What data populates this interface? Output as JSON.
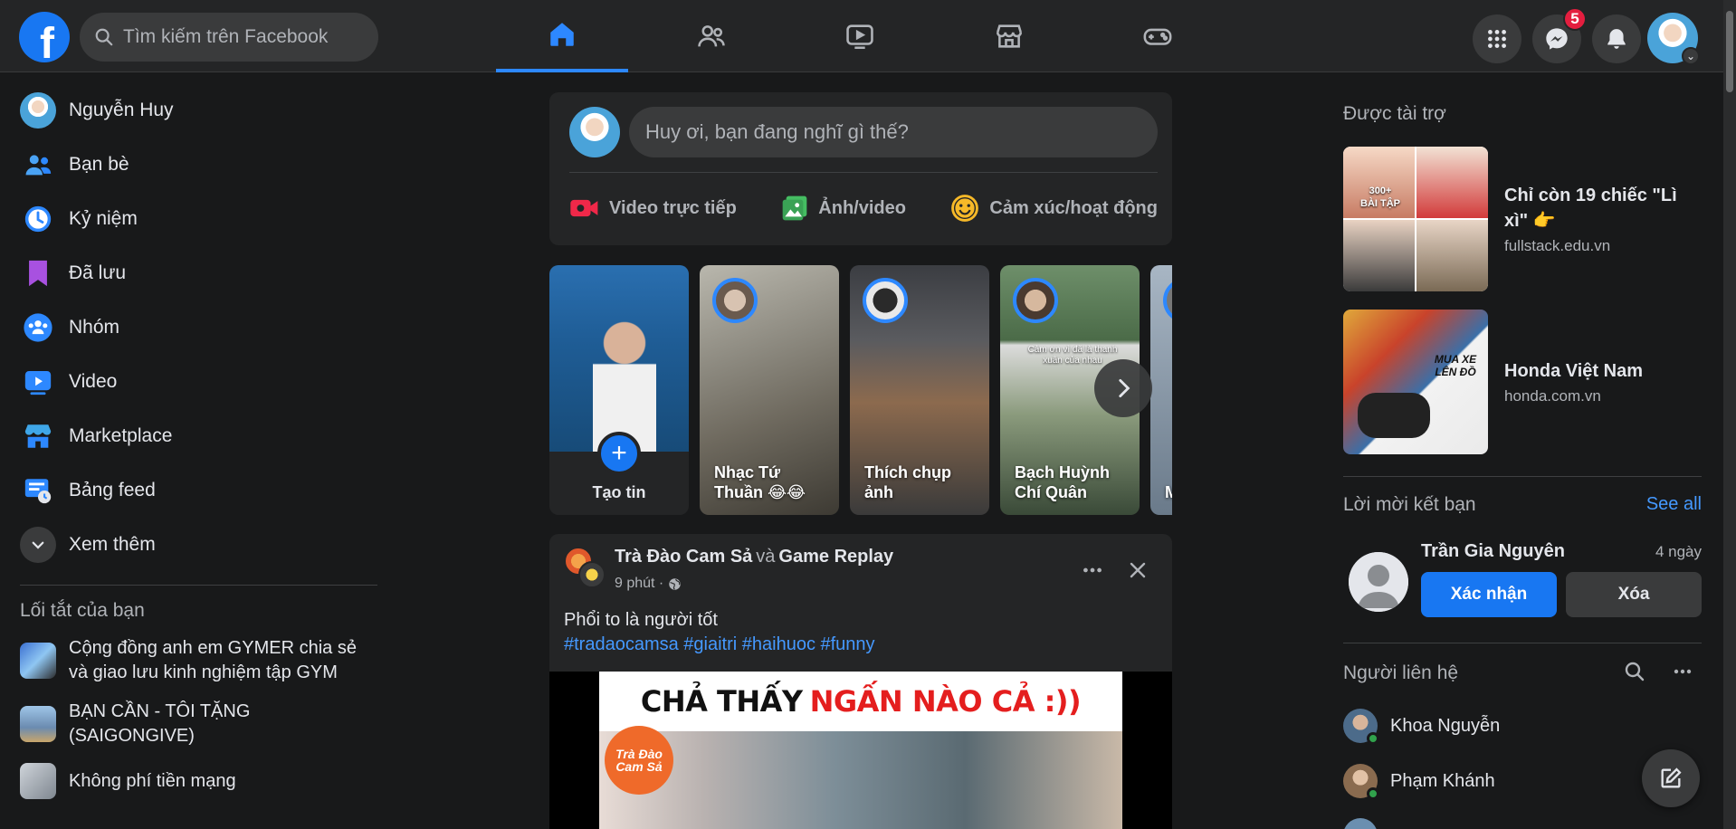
{
  "topbar": {
    "logo_letter": "f",
    "search_placeholder": "Tìm kiếm trên Facebook",
    "nav_tabs": [
      {
        "name": "home",
        "icon": "home-icon",
        "active": true
      },
      {
        "name": "friends",
        "icon": "friends-icon",
        "active": false
      },
      {
        "name": "watch",
        "icon": "video-icon",
        "active": false
      },
      {
        "name": "marketplace",
        "icon": "store-icon",
        "active": false
      },
      {
        "name": "gaming",
        "icon": "gamepad-icon",
        "active": false
      }
    ],
    "messenger_badge": "5"
  },
  "sidebar": {
    "items": [
      {
        "label": "Nguyễn Huy",
        "icon": "profile-avatar"
      },
      {
        "label": "Bạn bè",
        "icon": "friends-icon"
      },
      {
        "label": "Kỷ niệm",
        "icon": "memories-clock-icon"
      },
      {
        "label": "Đã lưu",
        "icon": "bookmark-icon"
      },
      {
        "label": "Nhóm",
        "icon": "groups-icon"
      },
      {
        "label": "Video",
        "icon": "video-play-icon"
      },
      {
        "label": "Marketplace",
        "icon": "marketplace-icon"
      },
      {
        "label": "Bảng feed",
        "icon": "feed-icon"
      },
      {
        "label": "Xem thêm",
        "icon": "chevron-down-icon"
      }
    ],
    "shortcuts_heading": "Lối tắt của bạn",
    "shortcuts": [
      {
        "label": "Cộng đồng anh em GYMER chia sẻ và giao lưu kinh nghiệm tập GYM"
      },
      {
        "label": "BẠN CẦN - TÔI TẶNG (SAIGONGIVE)"
      },
      {
        "label": "Không phí tiền mạng"
      }
    ]
  },
  "composer": {
    "placeholder": "Huy ơi, bạn đang nghĩ gì thế?",
    "actions": [
      {
        "label": "Video trực tiếp",
        "icon": "live-video-icon",
        "color": "#f02849"
      },
      {
        "label": "Ảnh/video",
        "icon": "photo-icon",
        "color": "#45bd62"
      },
      {
        "label": "Cảm xúc/hoạt động",
        "icon": "smiley-icon",
        "color": "#f7b928"
      }
    ]
  },
  "stories": {
    "create_label": "Tạo tin",
    "items": [
      {
        "name": "Nhạc Tứ Thuần 😂😂"
      },
      {
        "name": "Thích chụp ảnh"
      },
      {
        "name": "Bạch Huỳnh Chí Quân"
      },
      {
        "name": "M N"
      }
    ],
    "story4_overlay": "Cảm ơn vì đã là thanh xuân của nhau"
  },
  "post": {
    "page_name": "Trà Đào Cam Sả",
    "connector": "và",
    "group_name": "Game Replay",
    "time": "9 phút ·",
    "text": "Phổi to là người tốt",
    "hashtags": "#tradaocamsa #giaitri #haihuoc #funny",
    "caption_black": "CHẢ THẤY",
    "caption_red": "NGẤN NÀO CẢ :))",
    "logo_text": "Trà Đào Cam Sả"
  },
  "right": {
    "sponsored_heading": "Được tài trợ",
    "ads": [
      {
        "title": "Chỉ còn 19 chiếc \"Lì xì\" 👉",
        "domain": "fullstack.edu.vn",
        "img_badge": "300+ BÀI TẬP"
      },
      {
        "title": "Honda Việt Nam",
        "domain": "honda.com.vn",
        "img_text": "MUA XE LÊN ĐỒ"
      }
    ],
    "requests_heading": "Lời mời kết bạn",
    "see_all": "See all",
    "request": {
      "name": "Trần Gia Nguyên",
      "time": "4 ngày",
      "confirm": "Xác nhận",
      "delete": "Xóa"
    },
    "contacts_heading": "Người liên hệ",
    "contacts": [
      {
        "name": "Khoa Nguyễn"
      },
      {
        "name": "Phạm Khánh"
      }
    ]
  }
}
